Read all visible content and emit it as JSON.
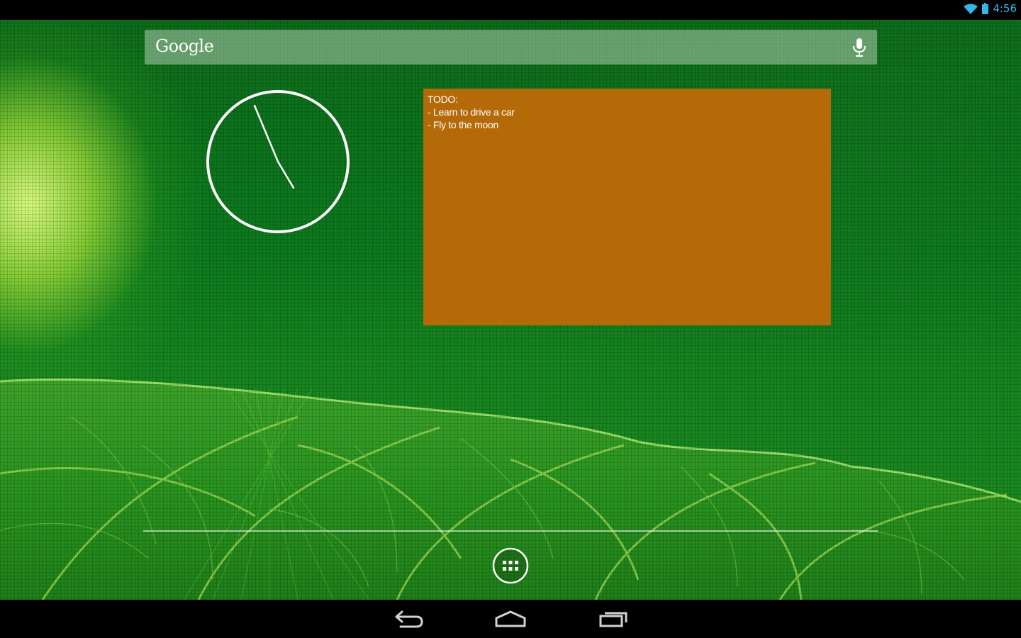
{
  "status_bar": {
    "time": "4:56",
    "icons": [
      "wifi-icon",
      "battery-icon"
    ],
    "accent_color": "#33b5e5"
  },
  "search_bar": {
    "logo_text": "Google",
    "icon": "mic-icon"
  },
  "clock_widget": {
    "type": "analog",
    "display_time": "4:56"
  },
  "note_widget": {
    "lines": [
      "TODO:",
      "- Learn to drive a car",
      "- Fly to the moon"
    ],
    "background_color": "#b46a08"
  },
  "dock": {
    "all_apps_icon": "all-apps-grid-icon"
  },
  "nav_bar": {
    "buttons": [
      "back-icon",
      "home-icon",
      "recents-icon"
    ]
  }
}
